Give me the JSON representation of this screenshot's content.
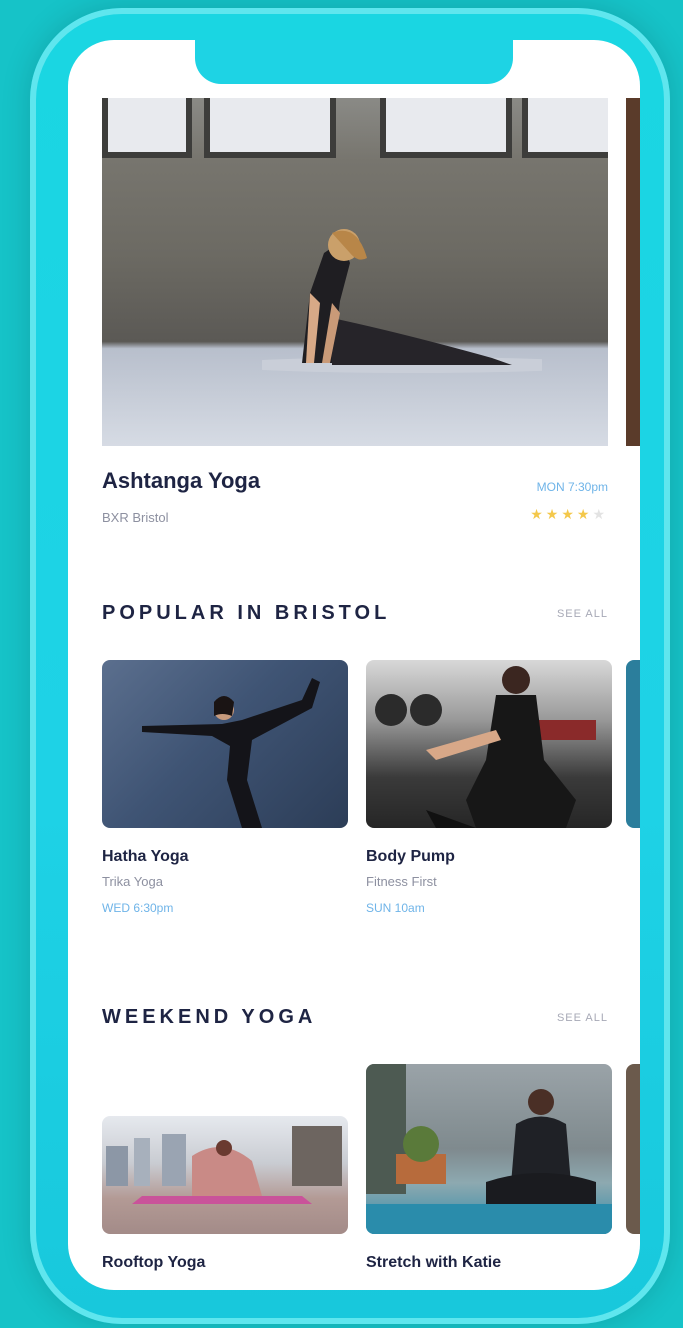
{
  "featured": {
    "title": "Ashtanga Yoga",
    "venue": "BXR Bristol",
    "time": "MON 7:30pm",
    "rating": 4,
    "rating_max": 5
  },
  "sections": [
    {
      "title": "POPULAR IN BRISTOL",
      "see_all": "SEE ALL",
      "cards": [
        {
          "title": "Hatha Yoga",
          "venue": "Trika Yoga",
          "time": "WED 6:30pm"
        },
        {
          "title": "Body Pump",
          "venue": "Fitness First",
          "time": "SUN 10am"
        }
      ]
    },
    {
      "title": "WEEKEND YOGA",
      "see_all": "SEE ALL",
      "cards": [
        {
          "title": "Rooftop Yoga"
        },
        {
          "title": "Stretch with Katie"
        }
      ]
    }
  ],
  "colors": {
    "background": "#16c3c8",
    "title": "#1e2443",
    "time": "#6fb4e8",
    "star_on": "#f4c84b"
  }
}
